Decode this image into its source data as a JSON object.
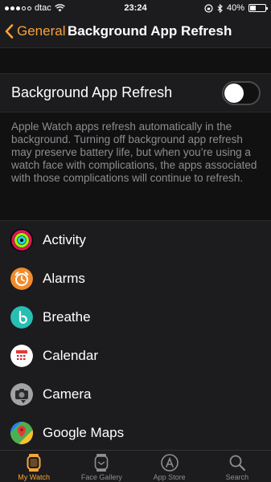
{
  "status_bar": {
    "carrier": "dtac",
    "time": "23:24",
    "battery": "40%",
    "battery_level": 0.4
  },
  "nav": {
    "back_label": "General",
    "title": "Background App Refresh"
  },
  "toggle": {
    "label": "Background App Refresh",
    "on": false
  },
  "description": "Apple Watch apps refresh automatically in the background. Turning off background app refresh may preserve battery life, but when you’re using a watch face with complications, the apps associated with those complications will continue to refresh.",
  "apps": [
    {
      "name": "Activity",
      "icon": "activity-icon"
    },
    {
      "name": "Alarms",
      "icon": "alarm-clock-icon"
    },
    {
      "name": "Breathe",
      "icon": "breathe-icon"
    },
    {
      "name": "Calendar",
      "icon": "calendar-icon"
    },
    {
      "name": "Camera",
      "icon": "camera-icon"
    },
    {
      "name": "Google Maps",
      "icon": "google-maps-icon"
    }
  ],
  "tabs": [
    {
      "label": "My Watch",
      "icon": "watch-icon",
      "active": true
    },
    {
      "label": "Face Gallery",
      "icon": "face-gallery-icon",
      "active": false
    },
    {
      "label": "App Store",
      "icon": "app-store-icon",
      "active": false
    },
    {
      "label": "Search",
      "icon": "search-icon",
      "active": false
    }
  ],
  "colors": {
    "accent": "#f7a33b",
    "background": "#1c1c1e"
  }
}
